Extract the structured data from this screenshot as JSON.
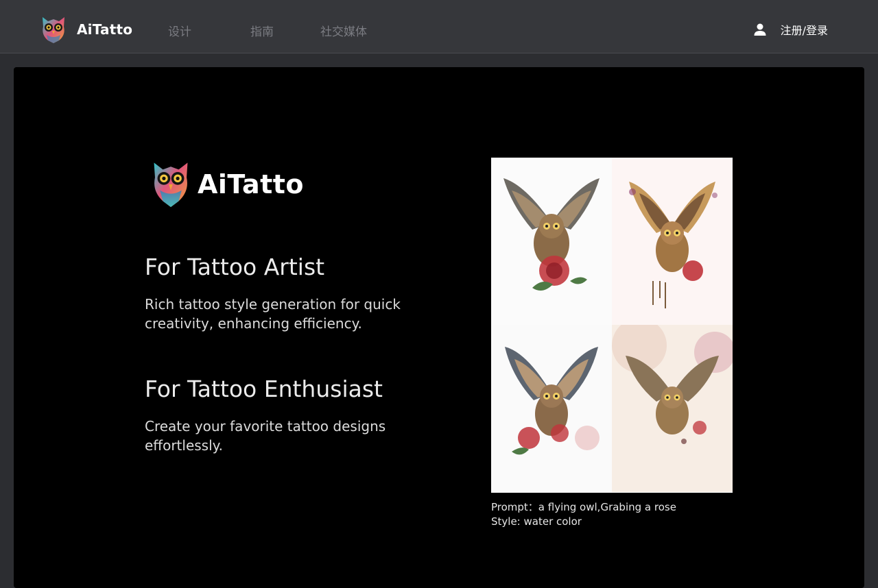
{
  "header": {
    "brand_name": "AiTatto",
    "nav": [
      {
        "label": "设计"
      },
      {
        "label": "指南"
      },
      {
        "label": "社交媒体"
      }
    ],
    "login_label": "注册/登录",
    "icons": {
      "logo": "owl-logo-icon",
      "user": "user-icon"
    }
  },
  "hero": {
    "logo_text": "AiTatto",
    "sections": [
      {
        "title": "For Tattoo Artist",
        "description": "Rich tattoo style generation for quick creativity, enhancing efficiency."
      },
      {
        "title": "For Tattoo Enthusiast",
        "description": "Create your favorite tattoo designs effortlessly."
      }
    ],
    "caption": {
      "prompt": "Prompt：a flying owl,Grabing a rose",
      "style": "Style: water color"
    }
  },
  "colors": {
    "header_bg": "#36373b",
    "page_bg": "#2c2d31",
    "hero_bg": "#000000",
    "nav_text": "#7b7c82",
    "accent_rose": "#c0343b"
  }
}
